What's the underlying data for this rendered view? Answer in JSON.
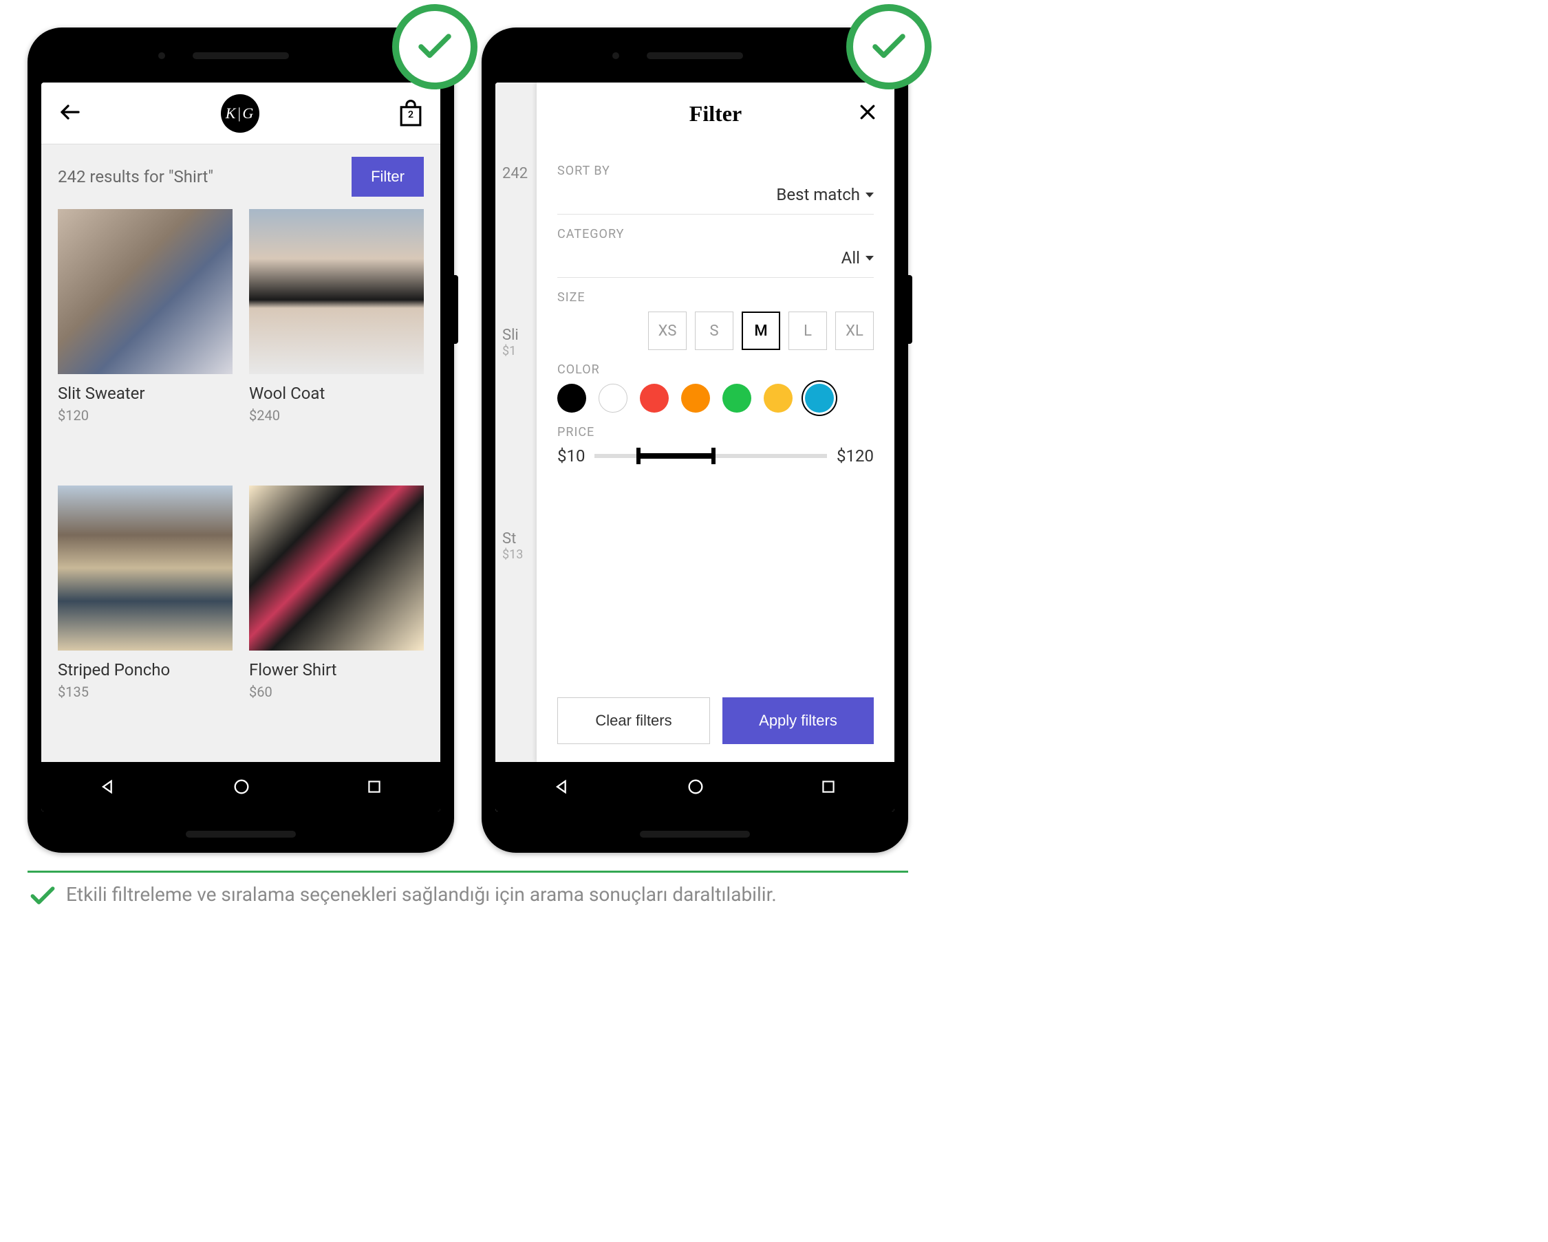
{
  "phone1": {
    "logo": "K|G",
    "bag_count": "2",
    "results_count": "242",
    "results_label_prefix": "results for",
    "results_query": "\"Shirt\"",
    "filter_button": "Filter",
    "products": [
      {
        "name": "Slit Sweater",
        "price": "$120"
      },
      {
        "name": "Wool Coat",
        "price": "$240"
      },
      {
        "name": "Striped Poncho",
        "price": "$135"
      },
      {
        "name": "Flower Shirt",
        "price": "$60"
      }
    ]
  },
  "phone2": {
    "bg_results_count": "242",
    "bg_product_a": "Sli",
    "bg_price_a": "$1",
    "bg_product_b": "St",
    "bg_price_b": "$13",
    "title": "Filter",
    "sort_by_label": "SORT BY",
    "sort_by_value": "Best match",
    "category_label": "CATEGORY",
    "category_value": "All",
    "size_label": "SIZE",
    "sizes": [
      "XS",
      "S",
      "M",
      "L",
      "XL"
    ],
    "size_selected": "M",
    "color_label": "COLOR",
    "colors": [
      {
        "name": "black",
        "hex": "#000000",
        "selected": false
      },
      {
        "name": "white",
        "hex": "#ffffff",
        "selected": false,
        "outline": true
      },
      {
        "name": "red",
        "hex": "#f44336",
        "selected": false
      },
      {
        "name": "orange",
        "hex": "#fb8c00",
        "selected": false
      },
      {
        "name": "green",
        "hex": "#21c24a",
        "selected": false
      },
      {
        "name": "yellow",
        "hex": "#fbc02d",
        "selected": false
      },
      {
        "name": "blue",
        "hex": "#12a9d4",
        "selected": true
      }
    ],
    "price_label": "PRICE",
    "price_min": "$10",
    "price_max": "$120",
    "clear_button": "Clear filters",
    "apply_button": "Apply filters"
  },
  "caption": "Etkili filtreleme ve sıralama seçenekleri sağlandığı için arama sonuçları daraltılabilir."
}
